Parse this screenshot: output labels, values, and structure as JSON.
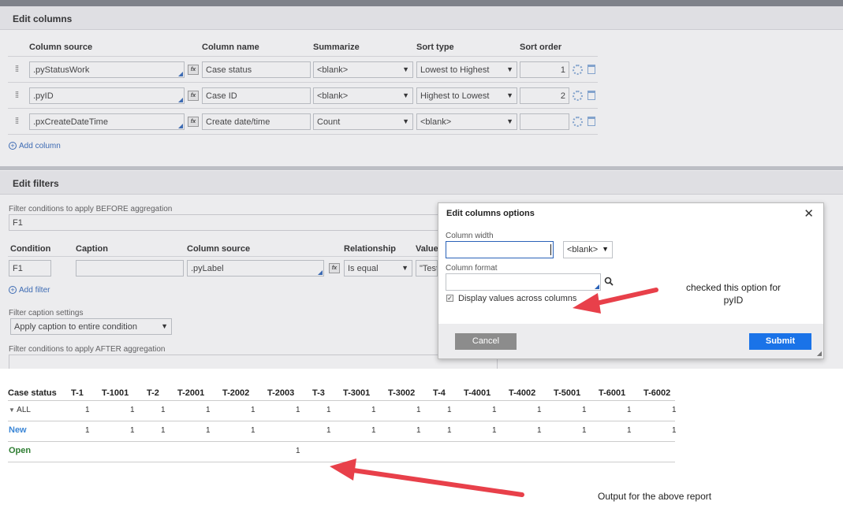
{
  "edit_columns": {
    "title": "Edit columns",
    "headers": [
      "Column source",
      "Column name",
      "Summarize",
      "Sort type",
      "Sort order"
    ],
    "rows": [
      {
        "source": ".pyStatusWork",
        "name": "Case status",
        "summarize": "<blank>",
        "sort_type": "Lowest to Highest",
        "sort_order": "1"
      },
      {
        "source": ".pyID",
        "name": "Case ID",
        "summarize": "<blank>",
        "sort_type": "Highest to Lowest",
        "sort_order": "2"
      },
      {
        "source": ".pxCreateDateTime",
        "name": "Create date/time",
        "summarize": "Count",
        "sort_type": "<blank>",
        "sort_order": ""
      }
    ],
    "add_column": "Add column",
    "fx_label": "fx"
  },
  "edit_filters": {
    "title": "Edit filters",
    "before_label": "Filter conditions to apply BEFORE aggregation",
    "before_value": "F1",
    "headers": [
      "Condition",
      "Caption",
      "Column source",
      "Relationship",
      "Value"
    ],
    "row": {
      "condition": "F1",
      "caption": "",
      "source": ".pyLabel",
      "relationship": "Is equal",
      "value": "\"Test"
    },
    "add_filter": "Add filter",
    "caption_settings_label": "Filter caption settings",
    "caption_settings_value": "Apply caption to entire condition",
    "after_label": "Filter conditions to apply AFTER aggregation"
  },
  "modal": {
    "title": "Edit columns options",
    "column_width_label": "Column width",
    "column_width_value": "",
    "width_unit": "<blank>",
    "column_format_label": "Column format",
    "column_format_value": "",
    "display_across_label": "Display values across columns",
    "display_across_checked": true,
    "cancel": "Cancel",
    "submit": "Submit"
  },
  "report": {
    "headers": [
      "Case status",
      "T-1",
      "T-1001",
      "T-2",
      "T-2001",
      "T-2002",
      "T-2003",
      "T-3",
      "T-3001",
      "T-3002",
      "T-4",
      "T-4001",
      "T-4002",
      "T-5001",
      "T-6001",
      "T-6002"
    ],
    "rows": [
      {
        "label": "ALL",
        "values": [
          "1",
          "1",
          "1",
          "1",
          "1",
          "1",
          "1",
          "1",
          "1",
          "1",
          "1",
          "1",
          "1",
          "1",
          "1"
        ]
      },
      {
        "label": "New",
        "values": [
          "1",
          "1",
          "1",
          "1",
          "1",
          "",
          "1",
          "1",
          "1",
          "1",
          "1",
          "1",
          "1",
          "1",
          "1"
        ]
      },
      {
        "label": "Open",
        "values": [
          "",
          "",
          "",
          "",
          "",
          "1",
          "",
          "",
          "",
          "",
          "",
          "",
          "",
          "",
          ""
        ]
      }
    ],
    "colors": {
      "new": "#3b86d6",
      "open": "#2e7d32"
    }
  },
  "annotations": {
    "checked_note": "checked this option for pyID",
    "output_note": "Output for the above report",
    "arrow_color": "#e8404a"
  }
}
